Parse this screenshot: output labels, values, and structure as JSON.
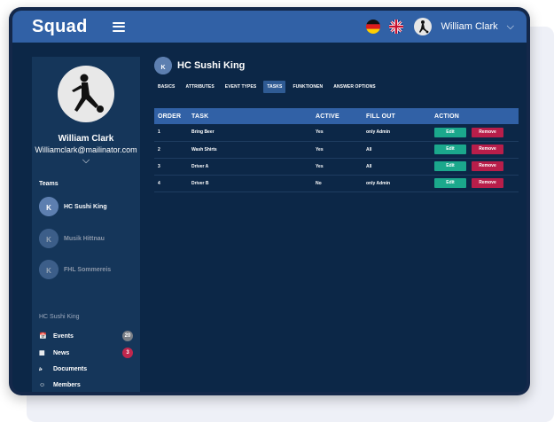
{
  "app": {
    "logo": "Squad",
    "user_name": "William Clark",
    "colors": {
      "topbar": "#3161a6",
      "background": "#0c2747",
      "sidebar": "#15365a",
      "edit": "#1ba88c",
      "remove": "#b81e4a",
      "badge_events": "#7a7f86",
      "badge_news": "#c0274d"
    }
  },
  "sidebar": {
    "name": "William Clark",
    "email": "Williamclark@mailinator.com",
    "teams_label": "Teams",
    "teams": [
      {
        "name": "HC Sushi King",
        "active": true
      },
      {
        "name": "Musik Hittnau",
        "active": false
      },
      {
        "name": "FHL Sommereis",
        "active": false
      }
    ],
    "club_label": "HC Sushi King",
    "menu": [
      {
        "label": "Events",
        "icon": "calendar-icon",
        "badge": "20"
      },
      {
        "label": "News",
        "icon": "news-icon",
        "badge": "3"
      },
      {
        "label": "Documents",
        "icon": "documents-icon",
        "badge": ""
      },
      {
        "label": "Members",
        "icon": "members-icon",
        "badge": ""
      }
    ]
  },
  "main": {
    "team_title": "HC Sushi King",
    "tabs": [
      "BASICS",
      "ATTRIBUTES",
      "EVENT TYPES",
      "TASKS",
      "FUNKTIONEN",
      "ANSWER OPTIONS"
    ],
    "active_tab": "TASKS",
    "table": {
      "headers": [
        "ORDER",
        "TASK",
        "ACTIVE",
        "FILL OUT",
        "ACTION"
      ],
      "edit_label": "Edit",
      "remove_label": "Remove",
      "rows": [
        {
          "order": "1",
          "task": "Bring Beer",
          "active": "Yes",
          "fill_out": "only Admin"
        },
        {
          "order": "2",
          "task": "Wash Shirts",
          "active": "Yes",
          "fill_out": "All"
        },
        {
          "order": "3",
          "task": "Driver A",
          "active": "Yes",
          "fill_out": "All"
        },
        {
          "order": "4",
          "task": "Driver B",
          "active": "No",
          "fill_out": "only Admin"
        }
      ]
    }
  }
}
